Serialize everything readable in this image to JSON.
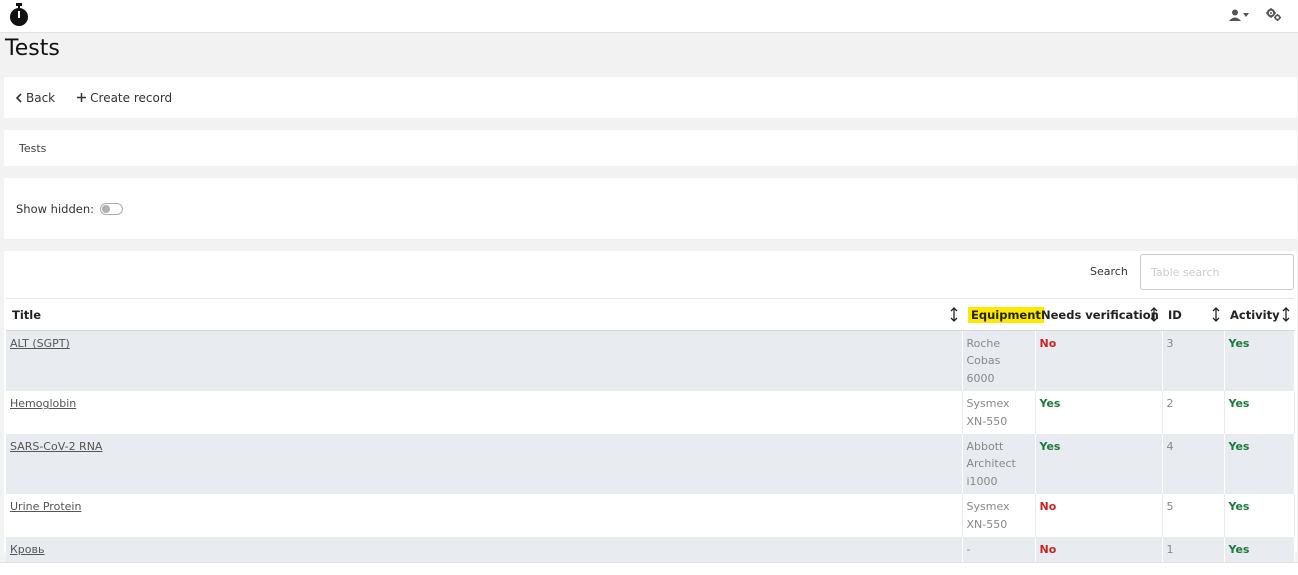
{
  "header": {
    "logo": "stopwatch-icon",
    "user_icon": "user-icon",
    "settings_icon": "gears-icon"
  },
  "page": {
    "title": "Tests"
  },
  "toolbar": {
    "back_label": "Back",
    "create_label": "Create record"
  },
  "breadcrumb": {
    "current": "Tests"
  },
  "filters": {
    "show_hidden_label": "Show hidden:",
    "show_hidden_value": false
  },
  "table": {
    "search_label": "Search",
    "search_placeholder": "Table search",
    "columns": [
      "Title",
      "Equipment",
      "Needs verification",
      "ID",
      "Activity"
    ],
    "rows": [
      {
        "title": "ALT (SGPT)",
        "equipment": "Roche Cobas 6000",
        "needs_verification": "No",
        "id": "3",
        "activity": "Yes"
      },
      {
        "title": "Hemoglobin",
        "equipment": "Sysmex XN-550",
        "needs_verification": "Yes",
        "id": "2",
        "activity": "Yes"
      },
      {
        "title": "SARS-CoV-2 RNA",
        "equipment": "Abbott Architect i1000",
        "needs_verification": "Yes",
        "id": "4",
        "activity": "Yes"
      },
      {
        "title": "Urine Protein",
        "equipment": "Sysmex XN-550",
        "needs_verification": "No",
        "id": "5",
        "activity": "Yes"
      },
      {
        "title": "Кровь",
        "equipment": "-",
        "needs_verification": "No",
        "id": "1",
        "activity": "Yes"
      }
    ]
  },
  "colors": {
    "yes": "#1a7a3a",
    "no": "#cc2222",
    "highlight": "#ffe800",
    "row_shade": "#e8ebf0"
  }
}
